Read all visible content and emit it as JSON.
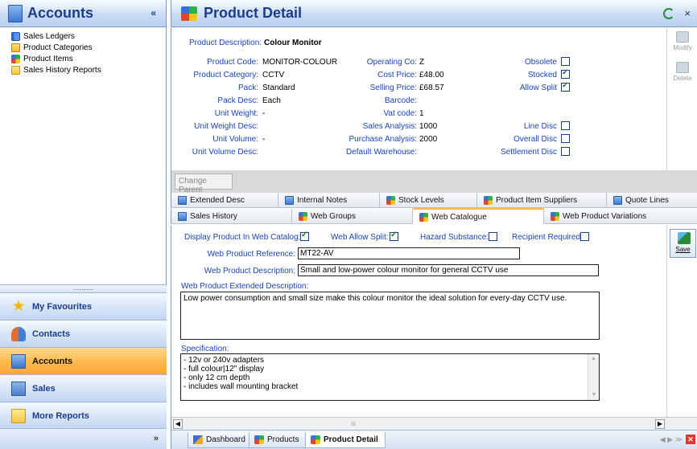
{
  "left": {
    "title": "Accounts",
    "collapse_glyph": "«",
    "tree": [
      {
        "label": "Sales Ledgers",
        "icon": "ledger-icon"
      },
      {
        "label": "Product Categories",
        "icon": "category-icon"
      },
      {
        "label": "Product Items",
        "icon": "product-items-icon"
      },
      {
        "label": "Sales History Reports",
        "icon": "folder-icon"
      }
    ],
    "splitter_dots": "..........",
    "nav": [
      {
        "label": "My Favourites",
        "icon": "star-icon"
      },
      {
        "label": "Contacts",
        "icon": "contacts-icon"
      },
      {
        "label": "Accounts",
        "icon": "accounts-icon"
      },
      {
        "label": "Sales",
        "icon": "sales-icon"
      },
      {
        "label": "More Reports",
        "icon": "folder-icon"
      }
    ],
    "more_glyph": "»"
  },
  "header": {
    "title": "Product Detail",
    "close_glyph": "×"
  },
  "detail": {
    "description_label": "Product Description:",
    "description": "Colour Monitor",
    "fields_left": [
      {
        "label": "Product Code:",
        "value": "MONITOR-COLOUR"
      },
      {
        "label": "Product Category:",
        "value": "CCTV"
      },
      {
        "label": "Pack:",
        "value": "Standard"
      },
      {
        "label": "Pack Desc:",
        "value": "Each"
      },
      {
        "label": "Unit Weight:",
        "value": "-"
      },
      {
        "label": "Unit Weight Desc:",
        "value": ""
      },
      {
        "label": "Unit Volume:",
        "value": "-"
      },
      {
        "label": "Unit Volume Desc:",
        "value": ""
      }
    ],
    "fields_mid": [
      {
        "label": "Operating Co:",
        "value": "Z"
      },
      {
        "label": "Cost Price:",
        "value": "£48.00"
      },
      {
        "label": "Selling Price:",
        "value": "£68.57"
      },
      {
        "label": "Barcode:",
        "value": ""
      },
      {
        "label": "Vat code:",
        "value": "1"
      },
      {
        "label": "Sales Analysis:",
        "value": "1000"
      },
      {
        "label": "Purchase Analysis:",
        "value": "2000"
      },
      {
        "label": "Default Warehouse:",
        "value": ""
      }
    ],
    "flags_top": [
      {
        "label": "Obsolete",
        "checked": false
      },
      {
        "label": "Stocked",
        "checked": true
      },
      {
        "label": "Allow Split",
        "checked": true
      }
    ],
    "flags_bottom": [
      {
        "label": "Line Disc",
        "checked": false
      },
      {
        "label": "Overall Disc",
        "checked": false
      },
      {
        "label": "Settlement Disc",
        "checked": false
      }
    ]
  },
  "tools": {
    "modify": "Modify",
    "delete": "Delete"
  },
  "change_parent": "Change Parent",
  "tabs_row1": [
    {
      "label": "Extended Desc",
      "icon": "document-icon"
    },
    {
      "label": "Internal Notes",
      "icon": "document-icon"
    },
    {
      "label": "Stock Levels",
      "icon": "product-items-icon"
    },
    {
      "label": "Product Item Suppliers",
      "icon": "product-items-icon"
    },
    {
      "label": "Quote Lines",
      "icon": "document-icon"
    }
  ],
  "tabs_row2": [
    {
      "label": "Sales History",
      "icon": "document-icon"
    },
    {
      "label": "Web Groups",
      "icon": "product-items-icon"
    },
    {
      "label": "Web Catalogue",
      "icon": "product-items-icon"
    },
    {
      "label": "Web Product Variations",
      "icon": "product-items-icon"
    }
  ],
  "web": {
    "display_label": "Display Product In Web Catalog:",
    "display_checked": true,
    "allow_split_label": "Web Allow Split:",
    "allow_split_checked": true,
    "hazard_label": "Hazard Substance:",
    "hazard_checked": false,
    "recipient_label": "Recipient Required:",
    "recipient_checked": false,
    "reference_label": "Web Product Reference:",
    "reference": "MT22-AV",
    "description_label": "Web Product Description:",
    "description": "Small and low-power colour monitor for general CCTV use",
    "extended_label": "Web Product Extended Description:",
    "extended": "Low power consumption and small size make this colour monitor the ideal solution for every-day CCTV use.",
    "spec_label": "Specification:",
    "spec_lines": [
      "- 12v or 240v adapters",
      "- full colour|12\" display",
      "- only 12 cm depth",
      "- includes wall mounting bracket"
    ]
  },
  "save_label": "Save",
  "bottom_tabs": [
    {
      "label": "Dashboard",
      "icon": "dashboard-icon"
    },
    {
      "label": "Products",
      "icon": "product-items-icon"
    },
    {
      "label": "Product Detail",
      "icon": "product-items-icon"
    }
  ],
  "scroll_grip": "III"
}
